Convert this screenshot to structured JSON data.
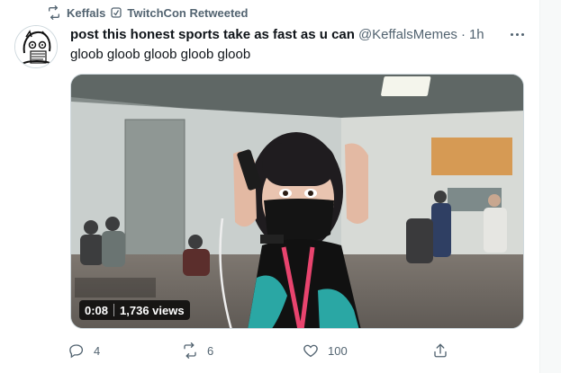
{
  "social_context": {
    "retweeter": "Keffals",
    "retweet_label": "TwitchCon Retweeted"
  },
  "tweet": {
    "author_name": "post this honest sports take as fast as u can",
    "author_handle": "@KeffalsMemes",
    "separator": "·",
    "time": "1h",
    "text": "gloob gloob gloob gloob gloob"
  },
  "video": {
    "duration": "0:08",
    "views": "1,736 views"
  },
  "actions": {
    "reply_count": "4",
    "retweet_count": "6",
    "like_count": "100"
  },
  "colors": {
    "muted": "#536471",
    "text": "#0f1419",
    "border": "#cfd9de"
  }
}
